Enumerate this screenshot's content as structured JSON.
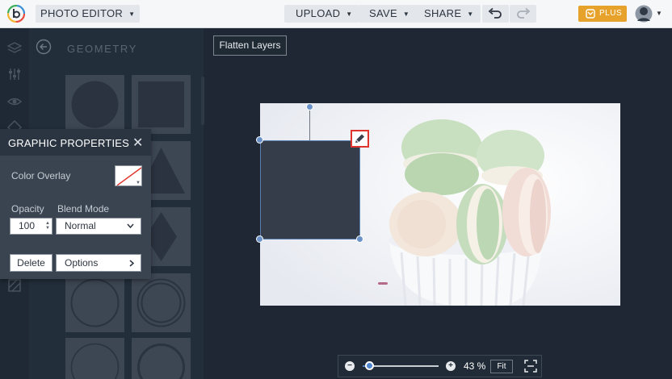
{
  "topbar": {
    "app_menu": "PHOTO EDITOR",
    "upload": "UPLOAD",
    "save": "SAVE",
    "share": "SHARE",
    "plus": "PLUS"
  },
  "geometry": {
    "title": "GEOMETRY"
  },
  "graphic_properties": {
    "title": "GRAPHIC PROPERTIES",
    "color_overlay_label": "Color Overlay",
    "opacity_label": "Opacity",
    "opacity_value": "100",
    "blend_mode_label": "Blend Mode",
    "blend_mode_value": "Normal",
    "delete_label": "Delete",
    "options_label": "Options"
  },
  "canvas": {
    "flatten_label": "Flatten Layers",
    "shape_fill": "#353c4a"
  },
  "zoom": {
    "value": "43 %",
    "fit_label": "Fit",
    "level": 0.1
  },
  "colors": {
    "accent": "#e7a22b",
    "selection": "#6b93c9",
    "highlight": "#e0342c"
  }
}
